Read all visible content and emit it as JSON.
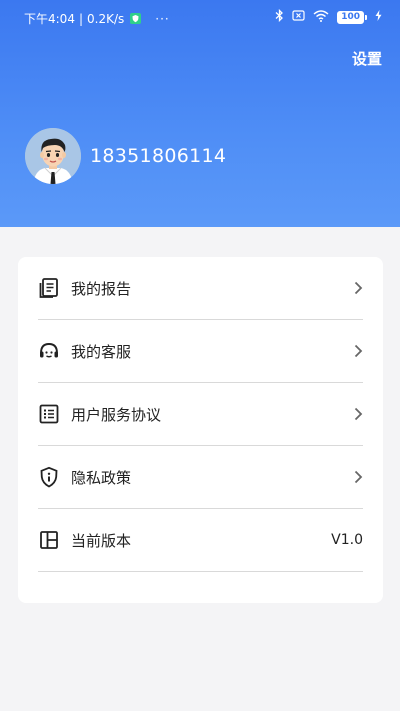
{
  "status_bar": {
    "time": "下午4:04",
    "speed": "0.2K/s",
    "dots": "···",
    "battery": "100"
  },
  "header": {
    "settings_label": "设置",
    "phone_number": "18351806114"
  },
  "menu": {
    "items": [
      {
        "label": "我的报告",
        "icon": "report-icon"
      },
      {
        "label": "我的客服",
        "icon": "customer-service-icon"
      },
      {
        "label": "用户服务协议",
        "icon": "agreement-icon"
      },
      {
        "label": "隐私政策",
        "icon": "privacy-shield-icon"
      },
      {
        "label": "当前版本",
        "icon": "version-icon",
        "value": "V1.0"
      }
    ]
  },
  "colors": {
    "header_top": "#3b78f0",
    "header_bottom": "#5b99f8",
    "page_background": "#f4f4f6"
  }
}
